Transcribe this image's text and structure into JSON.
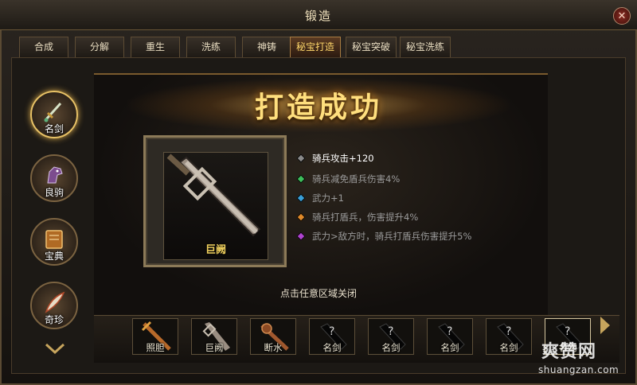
{
  "window": {
    "title": "锻造",
    "close_icon": "close-icon"
  },
  "tabs": [
    {
      "label": "合成",
      "active": false
    },
    {
      "label": "分解",
      "active": false
    },
    {
      "label": "重生",
      "active": false
    },
    {
      "label": "洗练",
      "active": false
    },
    {
      "label": "神铸",
      "active": false
    },
    {
      "label": "秘宝打造",
      "active": true
    },
    {
      "label": "秘宝突破",
      "active": false
    },
    {
      "label": "秘宝洗练",
      "active": false
    }
  ],
  "categories": [
    {
      "label": "名剑",
      "icon": "sword-icon",
      "active": true
    },
    {
      "label": "良驹",
      "icon": "horse-icon",
      "active": false
    },
    {
      "label": "宝典",
      "icon": "book-icon",
      "active": false
    },
    {
      "label": "奇珍",
      "icon": "feather-icon",
      "active": false
    }
  ],
  "result": {
    "banner": "打造成功",
    "item_name": "巨阙",
    "item_icon": "greatsword-icon",
    "stats": [
      {
        "text": "骑兵攻击+120",
        "color": "#ffffff",
        "gem": "#8a8a8a"
      },
      {
        "text": "骑兵减免盾兵伤害4%",
        "color": "#9a9a9a",
        "gem": "#3fbf5c"
      },
      {
        "text": "武力+1",
        "color": "#9a9a9a",
        "gem": "#3aa0d8"
      },
      {
        "text": "骑兵打盾兵，伤害提升4%",
        "color": "#9a9a9a",
        "gem": "#e08a2a"
      },
      {
        "text": "武力>敌方时，骑兵打盾兵伤害提升5%",
        "color": "#9a9a9a",
        "gem": "#b044d0"
      }
    ],
    "close_hint": "点击任意区域关闭"
  },
  "tray": [
    {
      "label": "照胆",
      "icon": "sword-icon"
    },
    {
      "label": "巨阙",
      "icon": "greatsword-icon"
    },
    {
      "label": "断水",
      "icon": "sword-icon"
    },
    {
      "label": "名剑",
      "icon": "unknown-sword-icon"
    },
    {
      "label": "名剑",
      "icon": "unknown-sword-icon"
    },
    {
      "label": "名剑",
      "icon": "unknown-sword-icon"
    },
    {
      "label": "名剑",
      "icon": "unknown-sword-icon"
    },
    {
      "label": "名剑",
      "icon": "unknown-sword-icon"
    }
  ],
  "watermark": {
    "big": "爽赞网",
    "small": "shuangzan.com"
  },
  "colors": {
    "gold": "#ffdf7e",
    "frame": "#5a4a33",
    "accent": "#e8c266"
  }
}
